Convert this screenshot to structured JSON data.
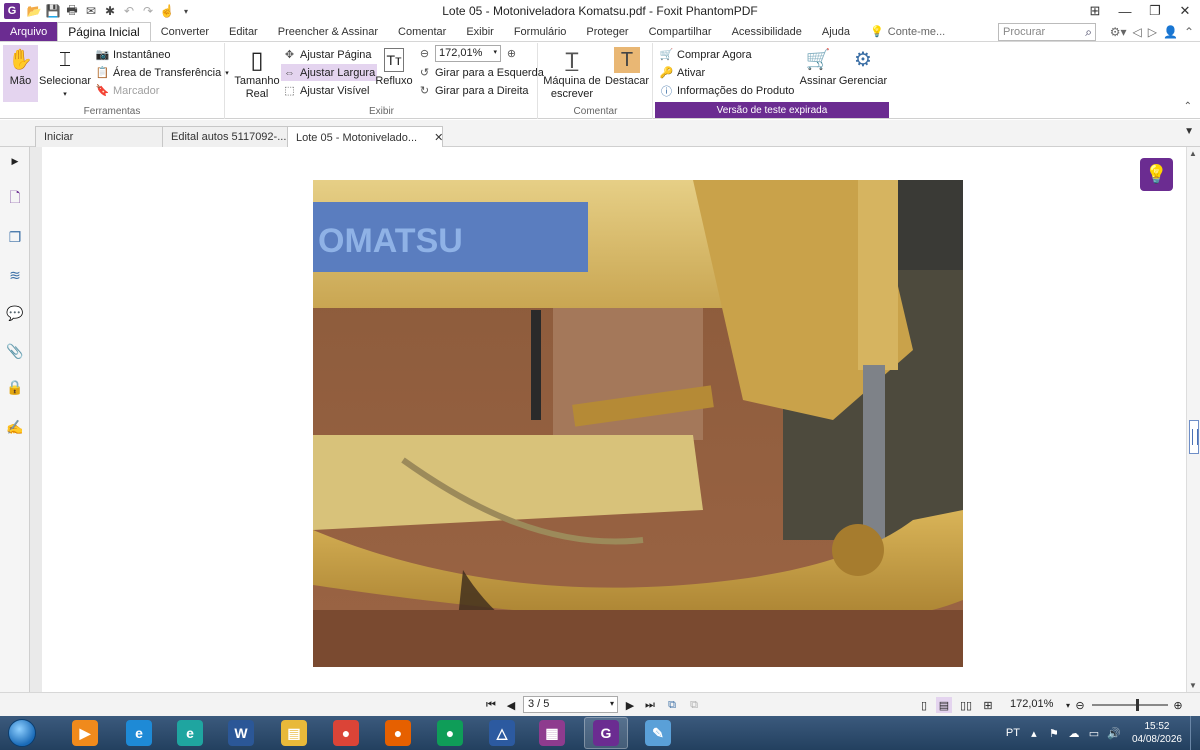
{
  "window": {
    "title": "Lote 05 - Motoniveladora Komatsu.pdf - Foxit PhantomPDF",
    "app_logo": "G"
  },
  "menu": {
    "file": "Arquivo",
    "items": [
      "Página Inicial",
      "Converter",
      "Editar",
      "Preencher & Assinar",
      "Comentar",
      "Exibir",
      "Formulário",
      "Proteger",
      "Compartilhar",
      "Acessibilidade",
      "Ajuda"
    ],
    "active_index": 0,
    "tell_me": "Conte-me...",
    "search_placeholder": "Procurar"
  },
  "ribbon": {
    "ferramentas": {
      "label": "Ferramentas",
      "mao": "Mão",
      "selecionar": "Selecionar",
      "instantaneo": "Instantâneo",
      "area_transferencia": "Área de Transferência",
      "marcador": "Marcador"
    },
    "exibir": {
      "label": "Exibir",
      "tamanho_real_1": "Tamanho",
      "tamanho_real_2": "Real",
      "ajustar_pagina": "Ajustar Página",
      "ajustar_largura": "Ajustar Largura",
      "ajustar_visivel": "Ajustar Visível",
      "refluxo": "Refluxo",
      "zoom_value": "172,01%",
      "girar_esquerda": "Girar para a Esquerda",
      "girar_direita": "Girar para a Direita"
    },
    "comentar": {
      "label": "Comentar",
      "maquina_1": "Máquina de",
      "maquina_2": "escrever",
      "destacar": "Destacar"
    },
    "trial": {
      "comprar": "Comprar Agora",
      "ativar": "Ativar",
      "informacoes": "Informações do Produto",
      "assinar": "Assinar",
      "gerenciar": "Gerenciar",
      "banner": "Versão de teste expirada"
    }
  },
  "tabs": [
    {
      "label": "Iniciar"
    },
    {
      "label": "Edital autos 5117092-..."
    },
    {
      "label": "Lote 05 - Motonivelado..."
    }
  ],
  "navigation": {
    "page_display": "3 / 5",
    "zoom": "172,01%",
    "zoom_level_fraction": 0.58
  },
  "taskbar": {
    "language": "PT",
    "time": "15:52",
    "date": "04/08/2026",
    "apps": [
      {
        "name": "media-player-icon",
        "glyph": "▶",
        "color": "#f08a1c"
      },
      {
        "name": "internet-explorer-icon",
        "glyph": "e",
        "color": "#1e8ad6"
      },
      {
        "name": "edge-icon",
        "glyph": "e",
        "color": "#1fa5a0"
      },
      {
        "name": "word-icon",
        "glyph": "W",
        "color": "#2b5797"
      },
      {
        "name": "file-explorer-icon",
        "glyph": "▤",
        "color": "#e8b93a"
      },
      {
        "name": "chrome-icon",
        "glyph": "●",
        "color": "#db4437"
      },
      {
        "name": "firefox-icon",
        "glyph": "●",
        "color": "#e66000"
      },
      {
        "name": "chrome-profile-icon",
        "glyph": "●",
        "color": "#0f9d58"
      },
      {
        "name": "app-triangle-icon",
        "glyph": "△",
        "color": "#2c5aa0"
      },
      {
        "name": "winrar-icon",
        "glyph": "▦",
        "color": "#8e3b8e"
      },
      {
        "name": "foxit-pdf-icon",
        "glyph": "G",
        "color": "#6b2c91"
      },
      {
        "name": "paint-icon",
        "glyph": "✎",
        "color": "#5aa0d8"
      }
    ]
  },
  "colors": {
    "accent": "#6b2c91",
    "selected_bg": "#e4d4ef"
  }
}
